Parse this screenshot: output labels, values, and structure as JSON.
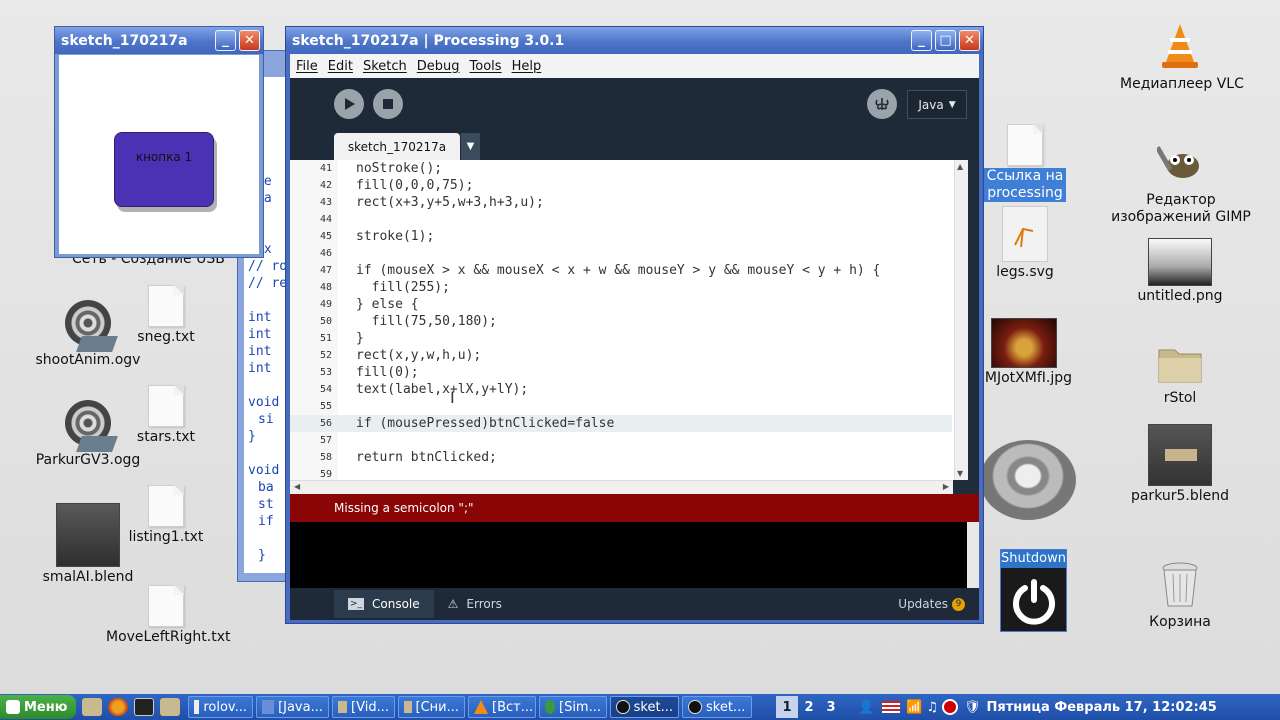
{
  "desktop_icons": {
    "vlc": "Медиаплеер VLC",
    "link_line1": "Ссылка на",
    "link_line2": "processing",
    "gimp_line1": "Редактор",
    "gimp_line2": "изображений GIMP",
    "legs": "legs.svg",
    "untitled": "untitled.png",
    "jpg": "7MJotXMfI.jpg",
    "rstol": "rStol",
    "parkur5": "parkur5.blend",
    "korzina": "Корзина",
    "shootanim": "shootAnim.ogv",
    "sneg": "sneg.txt",
    "parkurgv3": "ParkurGV3.ogg",
    "stars": "stars.txt",
    "smalai": "smalAI.blend",
    "listing1": "listing1.txt",
    "moveleftright": "MoveLeftRight.txt",
    "partial_net": "Сеть - Создание USB"
  },
  "sketch_window": {
    "title": "sketch_170217a",
    "button_label": "кнопка 1"
  },
  "bg_window": {
    "lines": [
      "Le",
      "Da",
      "h",
      "Ex",
      "// ro",
      "// re",
      "int",
      "int",
      "int",
      "int",
      "void",
      "si",
      "}",
      "void",
      "ba",
      "st",
      "if",
      "} "
    ]
  },
  "main_window": {
    "title": "sketch_170217a | Processing 3.0.1",
    "menu": [
      "File",
      "Edit",
      "Sketch",
      "Debug",
      "Tools",
      "Help"
    ],
    "mode": "Java",
    "tab_name": "sketch_170217a",
    "code_lines": [
      {
        "n": "41",
        "text": "noStroke();"
      },
      {
        "n": "42",
        "text": "fill(0,0,0,75);"
      },
      {
        "n": "43",
        "text": "rect(x+3,y+5,w+3,h+3,u);"
      },
      {
        "n": "44",
        "text": ""
      },
      {
        "n": "45",
        "text": "stroke(1);"
      },
      {
        "n": "46",
        "text": ""
      },
      {
        "n": "47",
        "text": "if (mouseX > x && mouseX < x + w && mouseY > y && mouseY < y + h) {"
      },
      {
        "n": "48",
        "text": "  fill(255);"
      },
      {
        "n": "49",
        "text": "} else {"
      },
      {
        "n": "50",
        "text": "  fill(75,50,180);"
      },
      {
        "n": "51",
        "text": "}"
      },
      {
        "n": "52",
        "text": "rect(x,y,w,h,u);"
      },
      {
        "n": "53",
        "text": "fill(0);"
      },
      {
        "n": "54",
        "text": "text(label,x+lX,y+lY);"
      },
      {
        "n": "55",
        "text": ""
      },
      {
        "n": "56",
        "text": "if (mousePressed)btnClicked=false"
      },
      {
        "n": "57",
        "text": ""
      },
      {
        "n": "58",
        "text": "return btnClicked;"
      },
      {
        "n": "59",
        "text": ""
      }
    ],
    "error_message": "Missing a semicolon \";\"",
    "console_tab": "Console",
    "errors_tab": "Errors",
    "updates_label": "Updates",
    "updates_count": "9"
  },
  "shutdown": {
    "label": "Shutdown"
  },
  "taskbar": {
    "start_label": "Меню",
    "tasks": [
      "rolov...",
      "[Java...",
      "[Vid...",
      "[Сни...",
      "[Вст...",
      "[Sim...",
      "sket...",
      "sket..."
    ],
    "workspaces": [
      "1",
      "2",
      "3"
    ],
    "clock": "Пятница Февраль 17, 12:02:45"
  },
  "colors": {
    "titlebar": "#4e75c9",
    "editor_bg": "#1e2a38",
    "error_bar": "#8a0606",
    "sketch_button": "#4b32b4",
    "taskbar": "#2a5bb8"
  }
}
